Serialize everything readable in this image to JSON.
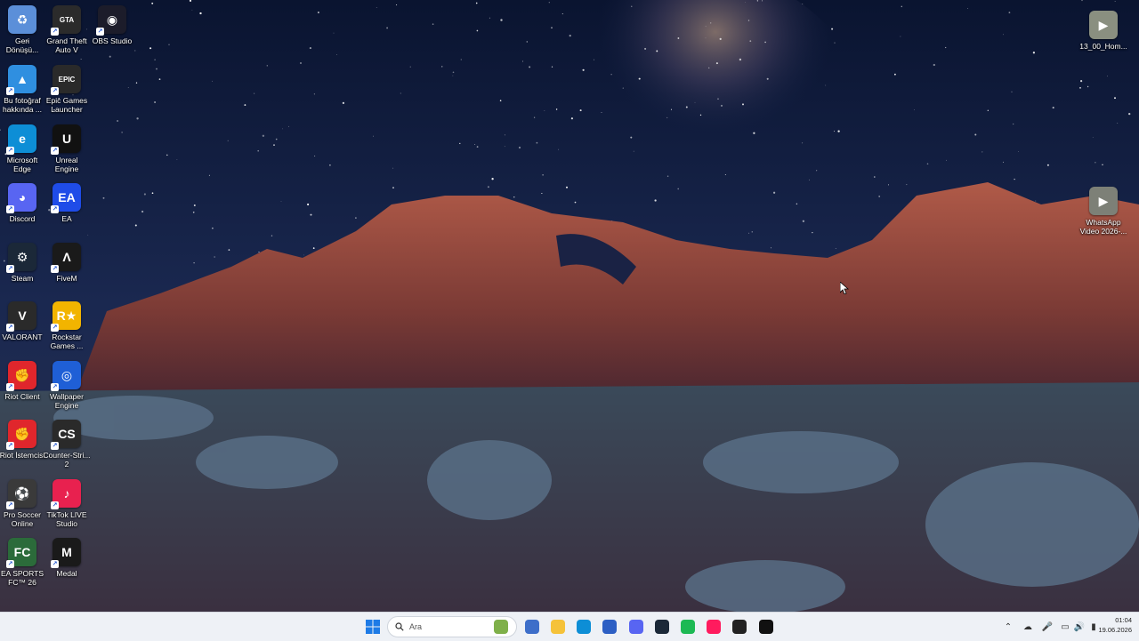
{
  "desktop_icons": [
    {
      "name": "recycle-bin",
      "label": "Geri\nDönüşü...",
      "icon": "recycle-bin-icon",
      "color": "#5b8fd9"
    },
    {
      "name": "gta-v",
      "label": "Grand Theft\nAuto V",
      "icon": "gta-icon",
      "color": "#2b2b2b"
    },
    {
      "name": "obs-studio",
      "label": "OBS Studio",
      "icon": "obs-icon",
      "color": "#1c1c2a"
    },
    {
      "name": "photo-info",
      "label": "Bu fotoğraf\nhakkında ...",
      "icon": "photo-icon",
      "color": "#2f8fe0"
    },
    {
      "name": "epic-games",
      "label": "Epic Games\nLauncher",
      "icon": "epic-icon",
      "color": "#2a2a2a"
    },
    {
      "name": "microsoft-edge",
      "label": "Microsoft\nEdge",
      "icon": "edge-icon",
      "color": "#0d8ed6"
    },
    {
      "name": "unreal-engine",
      "label": "Unreal\nEngine",
      "icon": "unreal-icon",
      "color": "#111"
    },
    {
      "name": "discord",
      "label": "Discord",
      "icon": "discord-icon",
      "color": "#5865f2"
    },
    {
      "name": "ea",
      "label": "EA",
      "icon": "ea-icon",
      "color": "#1f4ce8"
    },
    {
      "name": "steam",
      "label": "Steam",
      "icon": "steam-icon",
      "color": "#1b2838"
    },
    {
      "name": "fivem",
      "label": "FiveM",
      "icon": "fivem-icon",
      "color": "#1a1a1a"
    },
    {
      "name": "valorant",
      "label": "VALORANT",
      "icon": "valorant-icon",
      "color": "#2a2a2a"
    },
    {
      "name": "rockstar-games",
      "label": "Rockstar\nGames ...",
      "icon": "rockstar-icon",
      "color": "#f2b400"
    },
    {
      "name": "riot-client",
      "label": "Riot Client",
      "icon": "riot-icon",
      "color": "#e0262c"
    },
    {
      "name": "wallpaper-engine",
      "label": "Wallpaper\nEngine",
      "icon": "wallpaper-engine-icon",
      "color": "#1f5fd6"
    },
    {
      "name": "riot-istemcisi",
      "label": "Riot İstemcisi",
      "icon": "riot-icon",
      "color": "#e0262c"
    },
    {
      "name": "counter-strike",
      "label": "Counter-Stri...\n2",
      "icon": "cs2-icon",
      "color": "#2a2a2a"
    },
    {
      "name": "pro-soccer-online",
      "label": "Pro Soccer\nOnline",
      "icon": "soccer-icon",
      "color": "#3a3a3a"
    },
    {
      "name": "tiktok-live-studio",
      "label": "TikTok LIVE\nStudio",
      "icon": "tiktok-icon",
      "color": "#e8214f"
    },
    {
      "name": "ea-sports-fc",
      "label": "EA SPORTS\nFC™ 26",
      "icon": "fc26-icon",
      "color": "#2b6b3a"
    },
    {
      "name": "medal",
      "label": "Medal",
      "icon": "medal-icon",
      "color": "#1a1a1a"
    },
    {
      "name": "video-file-1",
      "label": "13_00_Hom...",
      "icon": "video-thumbnail-icon",
      "color": "#8a8f80"
    },
    {
      "name": "whatsapp-video",
      "label": "WhatsApp\nVideo 2026-...",
      "icon": "video-thumbnail-icon",
      "color": "#7d8077"
    }
  ],
  "icon_letters": {
    "recycle-bin-icon": "♻",
    "gta-icon": "GTA",
    "obs-icon": "◉",
    "photo-icon": "▲",
    "epic-icon": "EPIC",
    "edge-icon": "e",
    "unreal-icon": "U",
    "discord-icon": "◕",
    "ea-icon": "EA",
    "steam-icon": "⚙",
    "fivem-icon": "Λ",
    "valorant-icon": "V",
    "rockstar-icon": "R★",
    "riot-icon": "✊",
    "wallpaper-engine-icon": "◎",
    "cs2-icon": "CS",
    "soccer-icon": "⚽",
    "tiktok-icon": "♪",
    "fc26-icon": "FC",
    "medal-icon": "M",
    "video-thumbnail-icon": "▶"
  },
  "taskbar": {
    "search_placeholder": "Ara",
    "pinned": [
      {
        "name": "widgets",
        "icon": "widgets-icon",
        "color": "#7fb04a"
      },
      {
        "name": "app-thumbnail",
        "icon": "app-icon",
        "color": "#3d6ec9"
      },
      {
        "name": "file-explorer",
        "icon": "folder-icon",
        "color": "#f5c23a"
      },
      {
        "name": "edge",
        "icon": "edge-icon",
        "color": "#0d8ed6"
      },
      {
        "name": "microsoft-store",
        "icon": "store-icon",
        "color": "#2d5fc4"
      },
      {
        "name": "discord",
        "icon": "discord-icon",
        "color": "#5865f2"
      },
      {
        "name": "steam",
        "icon": "steam-icon",
        "color": "#1b2838"
      },
      {
        "name": "spotify",
        "icon": "spotify-icon",
        "color": "#1db954"
      },
      {
        "name": "opera-gx",
        "icon": "opera-icon",
        "color": "#ff1b5e"
      },
      {
        "name": "obs",
        "icon": "obs-icon",
        "color": "#222"
      },
      {
        "name": "medal",
        "icon": "medal-icon",
        "color": "#111"
      }
    ],
    "tray": [
      "chevron-up-icon",
      "cloud-icon",
      "microphone-icon",
      "network-icon",
      "volume-icon",
      "battery-icon"
    ],
    "time": "01:04",
    "date": "19.06.2026"
  }
}
